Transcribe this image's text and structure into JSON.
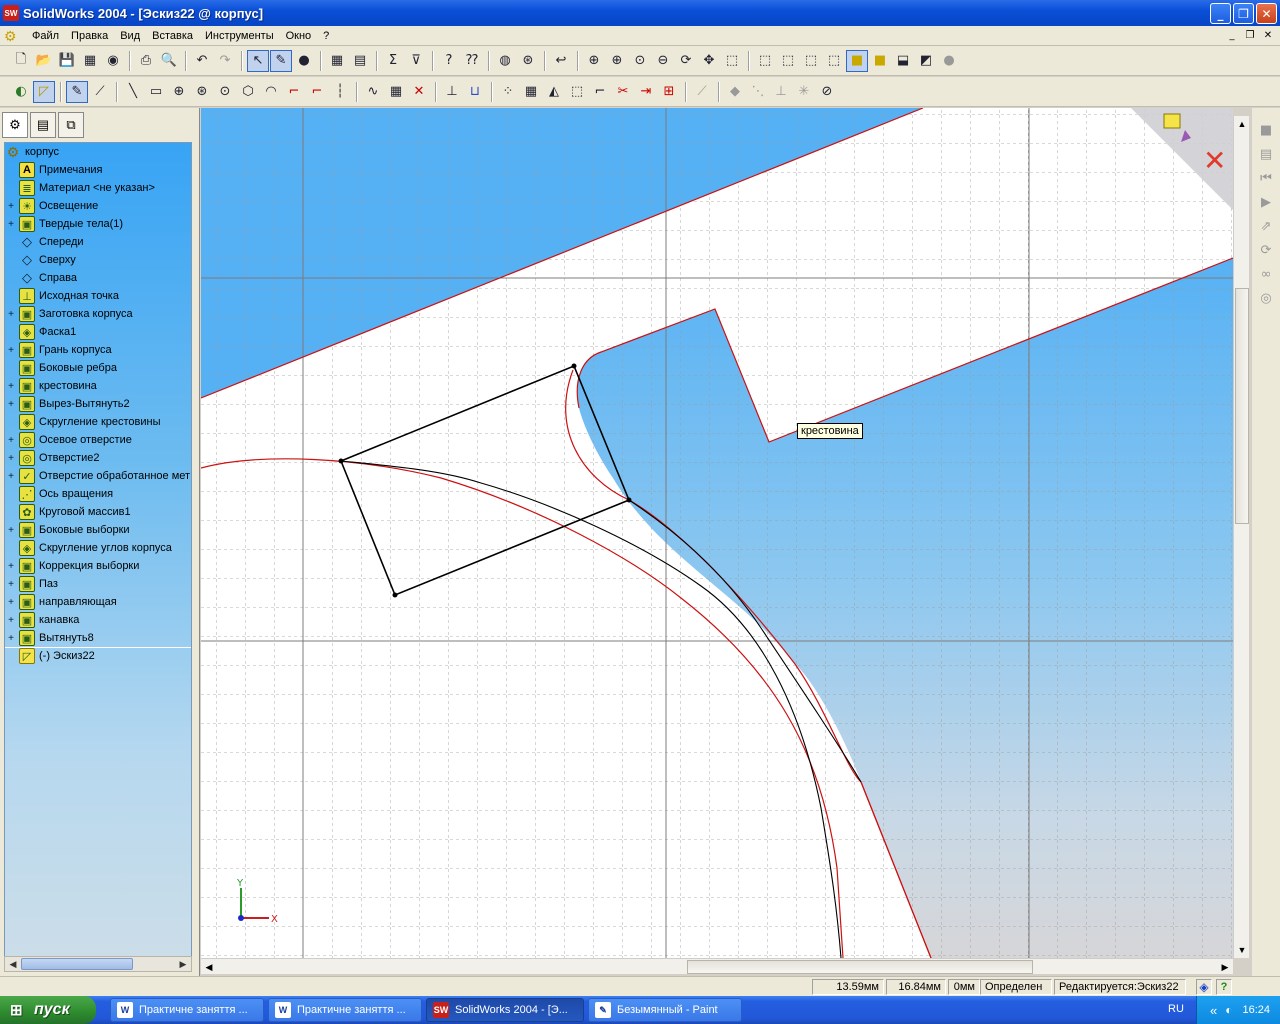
{
  "window": {
    "title": "SolidWorks 2004 - [Эскиз22 @ корпус]",
    "app_icon_text": "SW",
    "buttons": [
      "_",
      "❐",
      "✕"
    ]
  },
  "menu": {
    "items": [
      "Файл",
      "Правка",
      "Вид",
      "Вставка",
      "Инструменты",
      "Окно",
      "?"
    ],
    "mdi_buttons": [
      "_",
      "❐",
      "✕"
    ]
  },
  "toolbar1": {
    "icons": [
      "new-icon",
      "open-icon",
      "save-icon",
      "print-icon",
      "undo-icon",
      "redo-icon",
      "select-icon",
      "sketch-icon",
      "rebuild-icon",
      "zoom-icon",
      "rotate-icon",
      "pan-icon",
      "view-orientation-icon",
      "shaded-icon"
    ]
  },
  "toolbar2": {
    "icons": [
      "sketch-icon",
      "smart-dimension-icon",
      "line-icon",
      "rectangle-icon",
      "circle-icon",
      "arc-icon",
      "polygon-icon",
      "spline-icon",
      "mirror-icon",
      "trim-icon",
      "relations-icon"
    ]
  },
  "feature_tree": {
    "root": "корпус",
    "items": [
      {
        "label": "Примечания",
        "icon": "A",
        "expand": ""
      },
      {
        "label": "Материал <не указан>",
        "icon": "≣",
        "expand": ""
      },
      {
        "label": "Освещение",
        "icon": "☀",
        "expand": "+"
      },
      {
        "label": "Твердые тела(1)",
        "icon": "▣",
        "expand": "+"
      },
      {
        "label": "Спереди",
        "icon": "◇",
        "expand": ""
      },
      {
        "label": "Сверху",
        "icon": "◇",
        "expand": ""
      },
      {
        "label": "Справа",
        "icon": "◇",
        "expand": ""
      },
      {
        "label": "Исходная точка",
        "icon": "⊥",
        "expand": ""
      },
      {
        "label": "Заготовка корпуса",
        "icon": "▣",
        "expand": "+"
      },
      {
        "label": "Фаска1",
        "icon": "◈",
        "expand": ""
      },
      {
        "label": "Грань корпуса",
        "icon": "▣",
        "expand": "+"
      },
      {
        "label": "Боковые ребра",
        "icon": "▣",
        "expand": ""
      },
      {
        "label": "крестовина",
        "icon": "▣",
        "expand": "+"
      },
      {
        "label": "Вырез-Вытянуть2",
        "icon": "▣",
        "expand": "+"
      },
      {
        "label": "Скругление крестовины",
        "icon": "◈",
        "expand": ""
      },
      {
        "label": "Осевое отверстие",
        "icon": "◎",
        "expand": "+"
      },
      {
        "label": "Отверстие2",
        "icon": "◎",
        "expand": "+"
      },
      {
        "label": "Отверстие обработанное мет",
        "icon": "✓",
        "expand": "+"
      },
      {
        "label": "Ось вращения",
        "icon": "⋰",
        "expand": ""
      },
      {
        "label": "Круговой массив1",
        "icon": "✿",
        "expand": ""
      },
      {
        "label": "Боковые выборки",
        "icon": "▣",
        "expand": "+"
      },
      {
        "label": "Скругление углов корпуса",
        "icon": "◈",
        "expand": ""
      },
      {
        "label": "Коррекция выборки",
        "icon": "▣",
        "expand": "+"
      },
      {
        "label": "Паз",
        "icon": "▣",
        "expand": "+"
      },
      {
        "label": "направляющая",
        "icon": "▣",
        "expand": "+"
      },
      {
        "label": "канавка",
        "icon": "▣",
        "expand": "+"
      },
      {
        "label": "Вытянуть8",
        "icon": "▣",
        "expand": "+"
      }
    ],
    "active_sketch": "(-) Эскиз22"
  },
  "graphics": {
    "tooltip": "крестовина",
    "axis_x": "X",
    "axis_y": "Y",
    "region_color": "#56b1f4",
    "sketch_line_color": "#000000",
    "edge_color": "#cc1111"
  },
  "statusbar": {
    "x": "13.59мм",
    "y": "16.84мм",
    "z": "0мм",
    "state": "Определен",
    "editing": "Редактируется:Эскиз22"
  },
  "taskbar": {
    "start": "пуск",
    "tasks": [
      {
        "label": "Практичне заняття ...",
        "icon": "W"
      },
      {
        "label": "Практичне заняття ...",
        "icon": "W"
      },
      {
        "label": "SolidWorks 2004 - [Э...",
        "icon": "SW"
      },
      {
        "label": "Безымянный - Paint",
        "icon": "✎"
      }
    ],
    "lang": "RU",
    "clock": "16:24"
  }
}
